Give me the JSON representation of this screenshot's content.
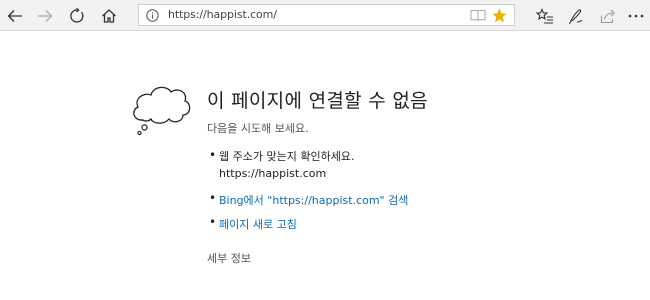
{
  "toolbar": {
    "url": "https://happist.com/",
    "icons": [
      "back-icon",
      "forward-icon",
      "refresh-icon",
      "home-icon",
      "info-icon",
      "reading-view-icon",
      "favorite-star-icon",
      "favorites-hub-icon",
      "pen-notes-icon",
      "share-icon",
      "more-icon"
    ],
    "colors": {
      "star": "#e8b400",
      "toolbar_bg": "#f2f2f2"
    }
  },
  "error": {
    "title": "이 페이지에 연결할 수 없음",
    "subtitle": "다음을 시도해 보세요.",
    "suggestion_check": "웹 주소가 맞는지 확인하세요.",
    "suggestion_check_url": "https://happist.com",
    "bing_search_link": "Bing에서 \"https://happist.com\" 검색",
    "refresh_link": "페이지 새로 고침",
    "details_link": "세부 정보",
    "link_color": "#0e6ab5"
  }
}
